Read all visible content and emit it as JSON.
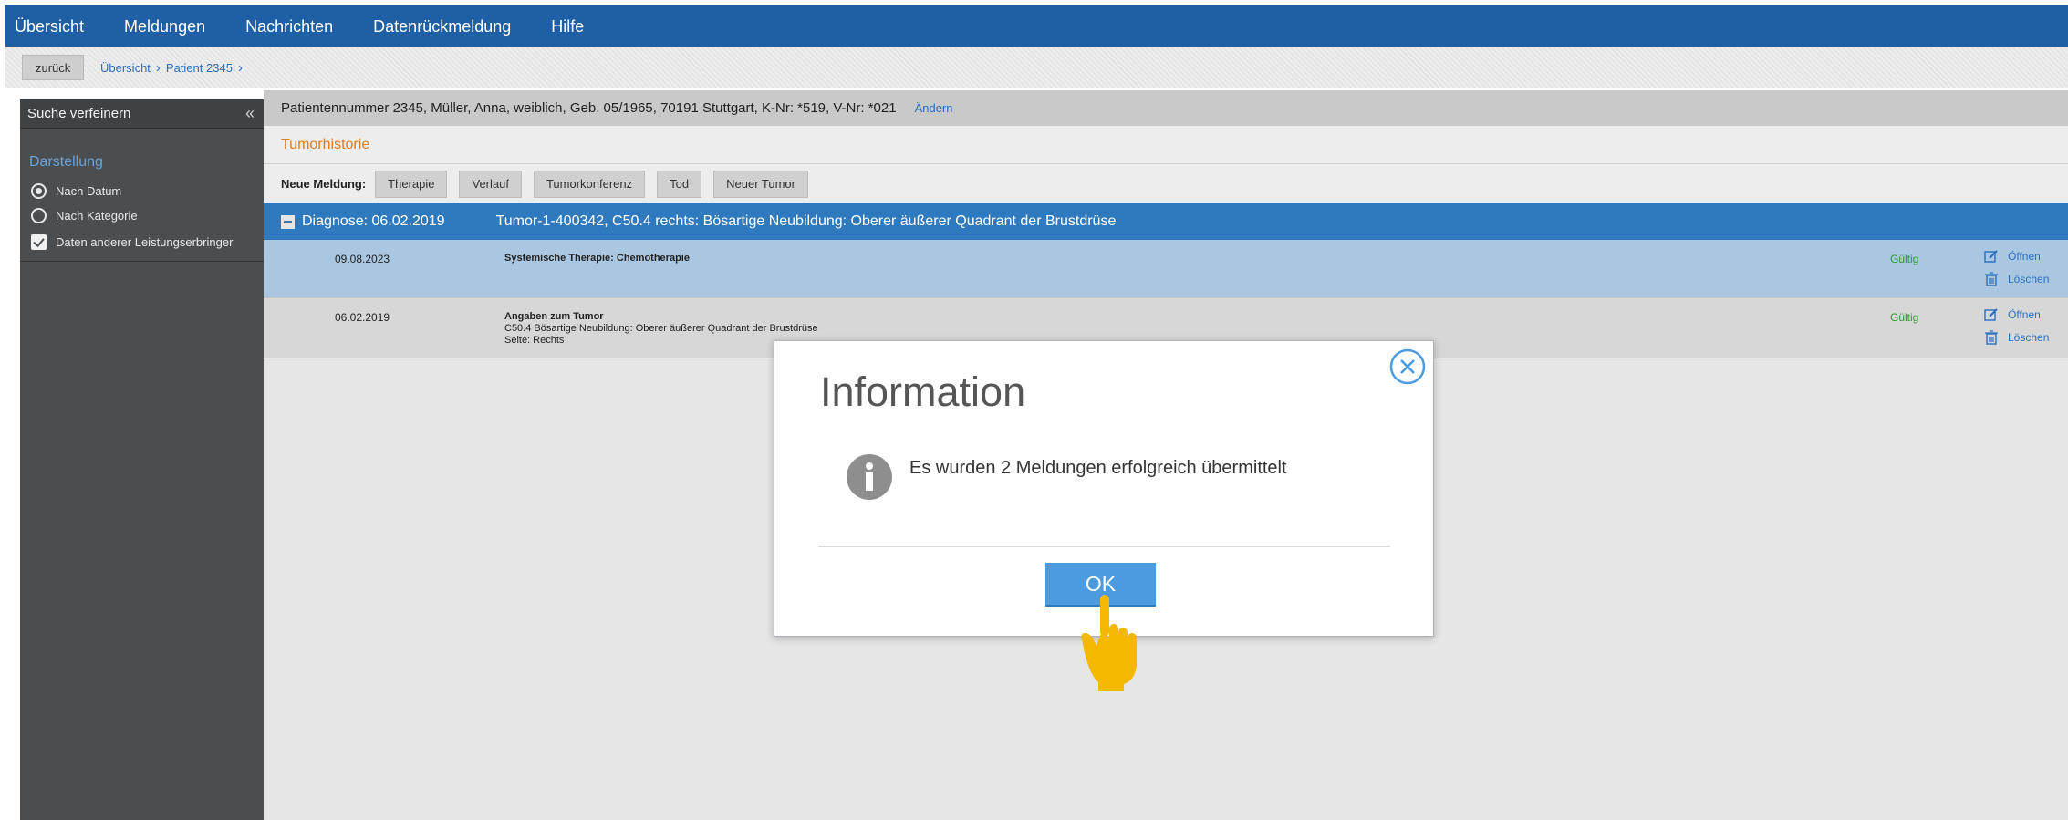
{
  "topnav": {
    "items": [
      "Übersicht",
      "Meldungen",
      "Nachrichten",
      "Datenrückmeldung",
      "Hilfe"
    ]
  },
  "breadcrumb": {
    "back_label": "zurück",
    "items": [
      "Übersicht",
      "Patient 2345"
    ]
  },
  "sidebar": {
    "title": "Suche verfeinern",
    "section": "Darstellung",
    "options": [
      {
        "label": "Nach Datum",
        "selected": true
      },
      {
        "label": "Nach Kategorie",
        "selected": false
      }
    ],
    "checkbox_label": "Daten anderer Leistungserbringer",
    "checkbox_checked": true
  },
  "main": {
    "patient_info": "Patientennummer 2345, Müller, Anna, weiblich, Geb. 05/1965, 70191 Stuttgart, K-Nr: *519, V-Nr: *021",
    "edit_label": "Ändern",
    "subheader": "Tumorhistorie",
    "new_message_label": "Neue Meldung:",
    "new_message_buttons": [
      "Therapie",
      "Verlauf",
      "Tumorkonferenz",
      "Tod",
      "Neuer Tumor"
    ],
    "diagnosis_date": "Diagnose: 06.02.2019",
    "diagnosis_text": "Tumor-1-400342, C50.4 rechts: Bösartige Neubildung: Oberer äußerer Quadrant der Brustdrüse",
    "rows": [
      {
        "date": "09.08.2023",
        "title": "Systemische Therapie: Chemotherapie",
        "line2": "",
        "line3": "",
        "status": "Gültig",
        "open": "Öffnen",
        "delete": "Löschen"
      },
      {
        "date": "06.02.2019",
        "title": "Angaben zum Tumor",
        "line2": "C50.4 Bösartige Neubildung: Oberer äußerer Quadrant der Brustdrüse",
        "line3": "Seite: Rechts",
        "status": "Gültig",
        "open": "Öffnen",
        "delete": "Löschen"
      }
    ]
  },
  "dialog": {
    "title": "Information",
    "message": "Es wurden 2 Meldungen erfolgreich übermittelt",
    "ok_label": "OK"
  },
  "colors": {
    "nav": "#1e5fa5",
    "accent_blue": "#2f79bf",
    "orange": "#e07a1f",
    "valid_green": "#2e9a2e",
    "sidebar": "#4b4e51"
  }
}
